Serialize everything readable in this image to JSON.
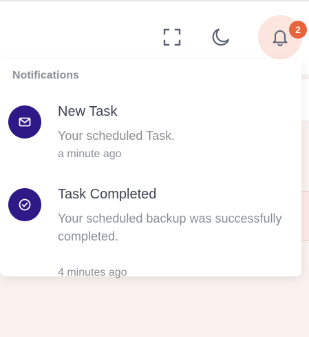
{
  "header": {
    "fullscreen_icon": "fullscreen-icon",
    "theme_icon": "moon-icon",
    "notifications_icon": "bell-icon",
    "notification_count": "2"
  },
  "notifications": {
    "title": "Notifications",
    "items": [
      {
        "icon": "envelope-icon",
        "title": "New Task",
        "message": "Your scheduled Task.",
        "time": "a minute ago"
      },
      {
        "icon": "check-circle-icon",
        "title": "Task Completed",
        "message": "Your scheduled backup was successfully completed.",
        "time": "4 minutes ago"
      }
    ]
  },
  "colors": {
    "accent": "#e8643f",
    "avatar": "#2e1a87",
    "bell_bg": "#fbe5de",
    "page_bg": "#f8f1ee"
  }
}
